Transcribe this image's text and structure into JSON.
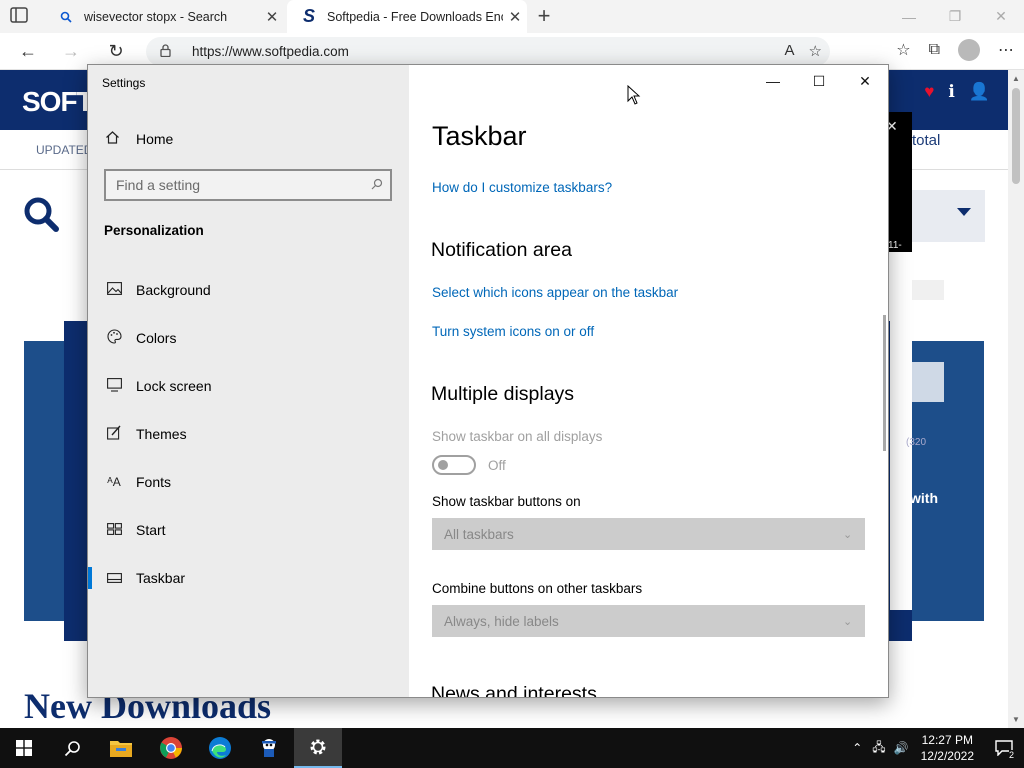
{
  "browser": {
    "tabs": [
      {
        "title": "wisevector stopx - Search",
        "favicon": "search-icon",
        "active": false
      },
      {
        "title": "Softpedia - Free Downloads Enc",
        "favicon": "softpedia-logo",
        "active": true
      }
    ],
    "new_tab_label": "+",
    "url": "https://www.softpedia.com"
  },
  "website": {
    "logo_text": "SOFT",
    "updated_text": "UPDATED O",
    "total_text": "total",
    "popup_text": "11-",
    "banner_text": "with",
    "new_downloads_heading": "New Downloads",
    "faint_text": "(320"
  },
  "settings": {
    "window_title": "Settings",
    "home_label": "Home",
    "search_placeholder": "Find a setting",
    "section_label": "Personalization",
    "nav_items": [
      {
        "label": "Background",
        "icon": "image-icon",
        "selected": false
      },
      {
        "label": "Colors",
        "icon": "palette-icon",
        "selected": false
      },
      {
        "label": "Lock screen",
        "icon": "monitor-icon",
        "selected": false
      },
      {
        "label": "Themes",
        "icon": "brush-icon",
        "selected": false
      },
      {
        "label": "Fonts",
        "icon": "font-icon",
        "selected": false
      },
      {
        "label": "Start",
        "icon": "start-grid-icon",
        "selected": false
      },
      {
        "label": "Taskbar",
        "icon": "taskbar-icon",
        "selected": true
      }
    ],
    "page_title": "Taskbar",
    "help_link": "How do I customize taskbars?",
    "notification_heading": "Notification area",
    "notif_link_1": "Select which icons appear on the taskbar",
    "notif_link_2": "Turn system icons on or off",
    "multiple_displays_heading": "Multiple displays",
    "show_all_displays_label": "Show taskbar on all displays",
    "show_all_displays_state": "Off",
    "show_buttons_on_label": "Show taskbar buttons on",
    "show_buttons_on_value": "All taskbars",
    "combine_label": "Combine buttons on other taskbars",
    "combine_value": "Always, hide labels",
    "cut_heading": "News and interests"
  },
  "taskbar": {
    "time": "12:27 PM",
    "date": "12/2/2022",
    "notification_count": "2",
    "apps": [
      "start-icon",
      "search-icon",
      "file-explorer-icon",
      "chrome-icon",
      "edge-icon",
      "app-icon",
      "settings-icon"
    ]
  },
  "colors": {
    "accent": "#0078d7",
    "link": "#0067b8",
    "softpedia_navy": "#0d2d6e"
  }
}
